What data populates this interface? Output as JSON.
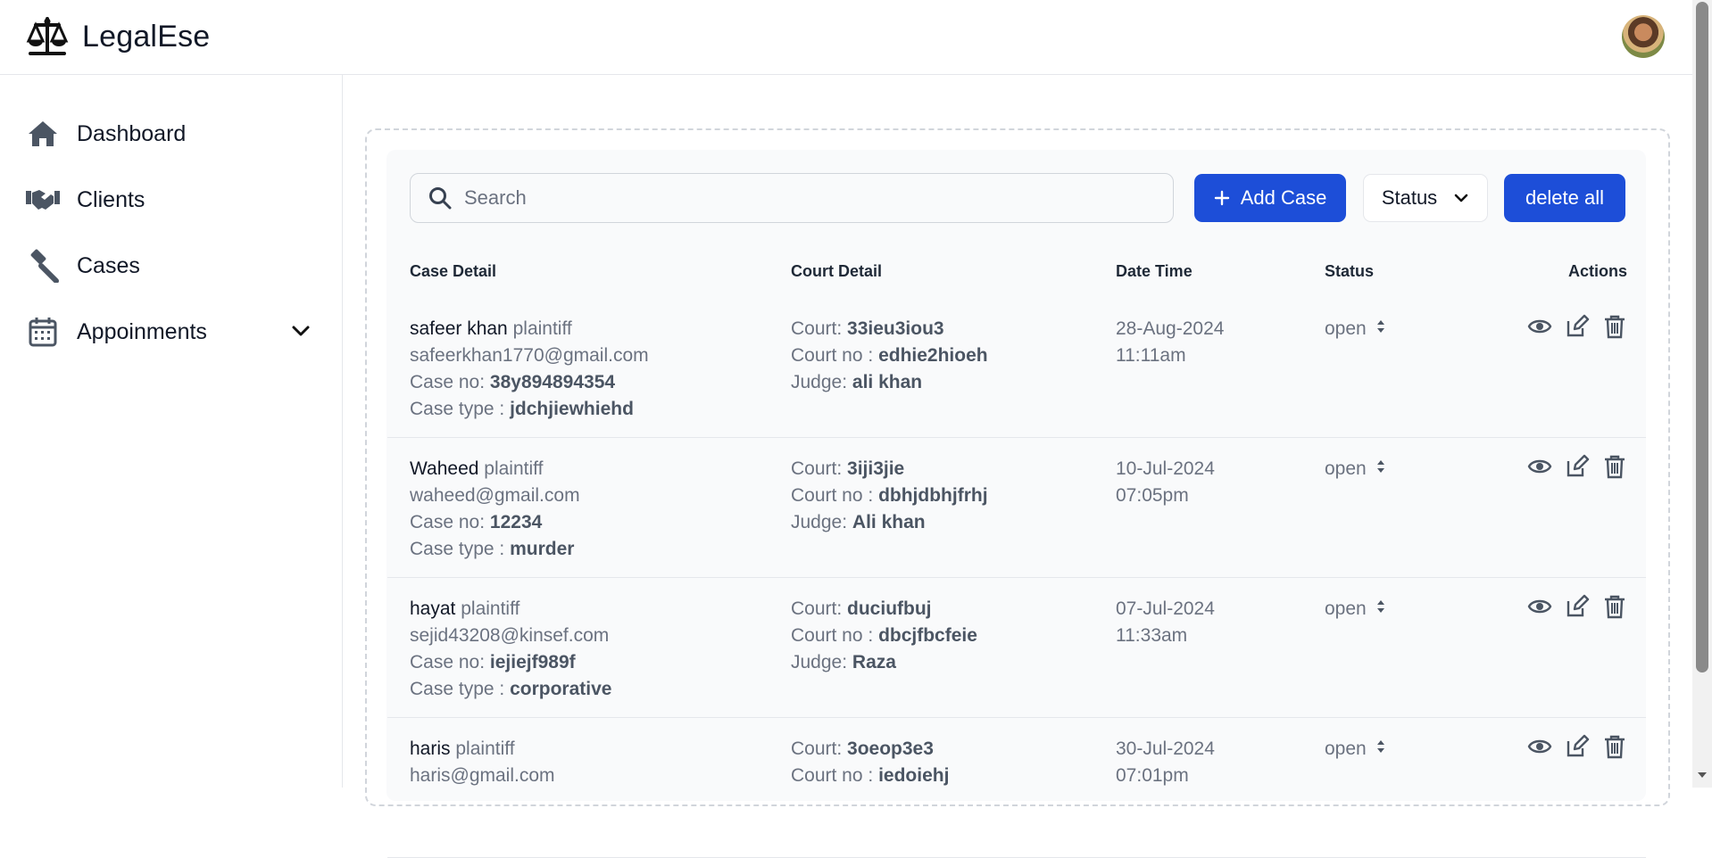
{
  "app": {
    "name": "LegalEse"
  },
  "sidebar": {
    "items": [
      {
        "label": "Dashboard",
        "icon": "home-icon"
      },
      {
        "label": "Clients",
        "icon": "handshake-icon"
      },
      {
        "label": "Cases",
        "icon": "gavel-icon"
      },
      {
        "label": "Appoinments",
        "icon": "calendar-icon"
      }
    ]
  },
  "toolbar": {
    "search_placeholder": "Search",
    "add_label": "Add Case",
    "status_label": "Status",
    "delete_all_label": "delete all"
  },
  "table": {
    "headers": {
      "case_detail": "Case Detail",
      "court_detail": "Court Detail",
      "date_time": "Date Time",
      "status": "Status",
      "actions": "Actions"
    },
    "labels": {
      "role": "plaintiff",
      "case_no": "Case no:",
      "case_type": "Case type :",
      "court": "Court:",
      "court_no": "Court no :",
      "judge": "Judge:"
    },
    "rows": [
      {
        "name": "safeer khan",
        "email": "safeerkhan1770@gmail.com",
        "case_no": "38y894894354",
        "case_type": "jdchjiewhiehd",
        "court": "33ieu3iou3",
        "court_no": "edhie2hioeh",
        "judge": "ali khan",
        "date": "28-Aug-2024",
        "time": "11:11am",
        "status": "open"
      },
      {
        "name": "Waheed",
        "email": "waheed@gmail.com",
        "case_no": "12234",
        "case_type": "murder",
        "court": "3iji3jie",
        "court_no": "dbhjdbhjfrhj",
        "judge": "Ali khan",
        "date": "10-Jul-2024",
        "time": "07:05pm",
        "status": "open"
      },
      {
        "name": "hayat",
        "email": "sejid43208@kinsef.com",
        "case_no": "iejiejf989f",
        "case_type": "corporative",
        "court": "duciufbuj",
        "court_no": "dbcjfbcfeie",
        "judge": "Raza",
        "date": "07-Jul-2024",
        "time": "11:33am",
        "status": "open"
      },
      {
        "name": "haris",
        "email": "haris@gmail.com",
        "case_no": "",
        "case_type": "",
        "court": "3oeop3e3",
        "court_no": "iedoiehj",
        "judge": "",
        "date": "30-Jul-2024",
        "time": "07:01pm",
        "status": "open"
      }
    ]
  },
  "colors": {
    "primary": "#1d4ed8",
    "icon": "#4b5563"
  }
}
